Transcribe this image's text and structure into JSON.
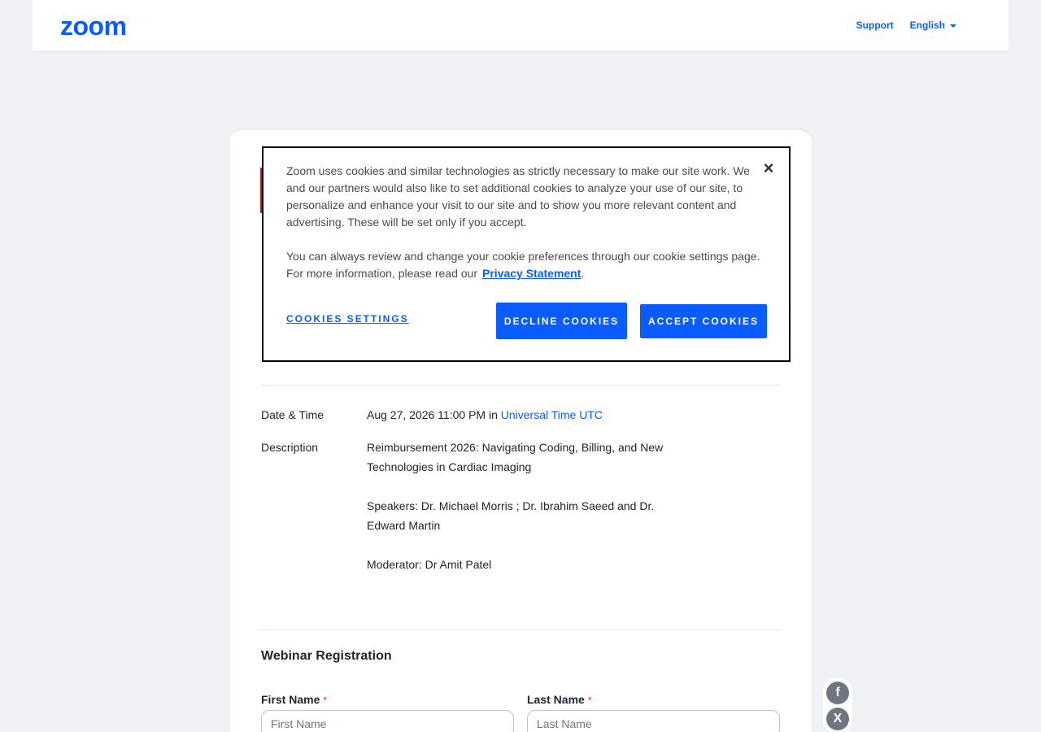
{
  "header": {
    "logo": "zoom",
    "nav": {
      "support": "Support",
      "language": "English"
    }
  },
  "webinar": {
    "date_time_label": "Date & Time",
    "date_time_value": "Aug 27, 2026 11:00 PM",
    "date_time_in": "in",
    "timezone": "Universal Time UTC",
    "description_label": "Description",
    "description_paragraphs": [
      "Reimbursement 2026: Navigating Coding, Billing, and New Technologies in Cardiac Imaging",
      "Speakers: Dr. Michael Morris ; Dr. Ibrahim Saeed and Dr. Edward Martin",
      "Moderator:  Dr Amit Patel"
    ]
  },
  "registration": {
    "title": "Webinar Registration",
    "first_name_label": "First Name",
    "first_name_placeholder": "First Name",
    "last_name_label": "Last Name",
    "last_name_placeholder": "Last Name",
    "required_mark": "*"
  },
  "cookie_banner": {
    "text_1": "Zoom uses cookies and similar technologies as strictly necessary to make our site work. We and our partners would also like to set additional cookies to analyze your use of our site, to personalize and enhance your visit to our site and to show you more relevant content and advertising. These will be set only if you accept.",
    "text_2": "You can always review and change your cookie preferences through our cookie settings page. For more information, please read our",
    "privacy_link": "Privacy Statement",
    "period": ".",
    "close": "×",
    "settings": "COOKIES SETTINGS",
    "decline": "DECLINE COOKIES",
    "accept": "ACCEPT COOKIES"
  },
  "share": {
    "facebook_glyph": "f",
    "x_glyph": "X"
  },
  "colors": {
    "brand": "#0b5cff",
    "required": "#e02828",
    "accent_mark": "#b71c1c"
  }
}
